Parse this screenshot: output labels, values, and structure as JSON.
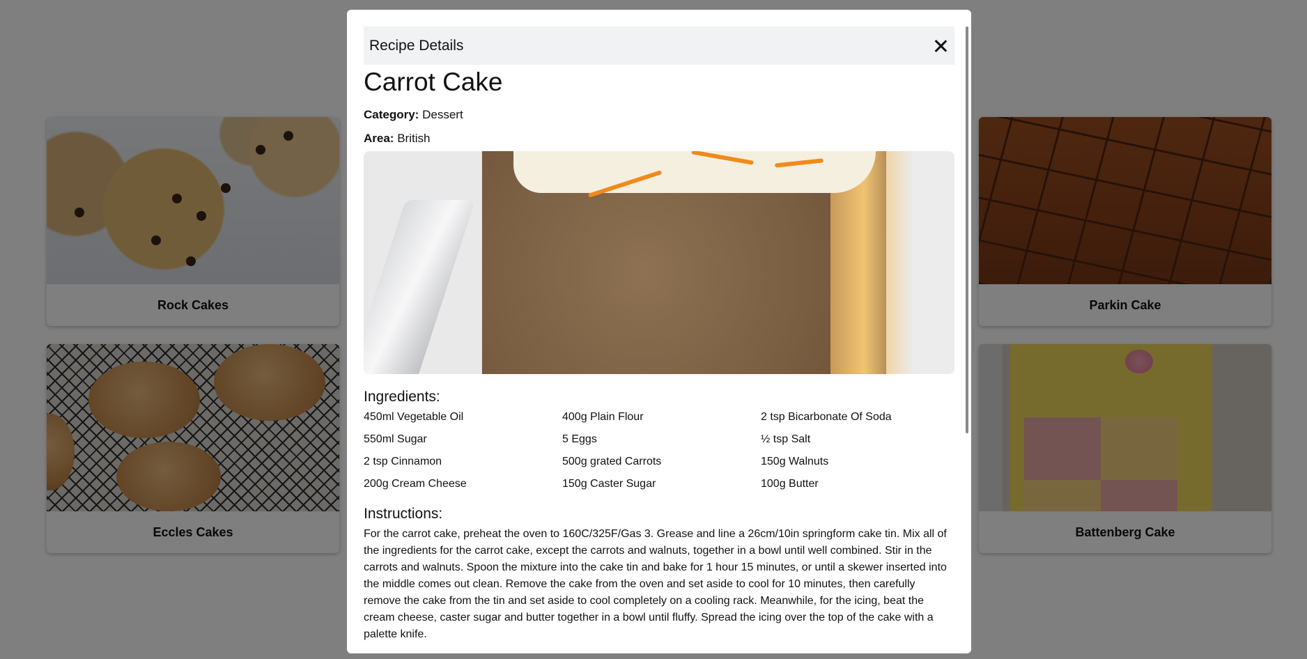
{
  "cards": [
    {
      "title": "Rock Cakes"
    },
    {
      "title": "Eccles Cakes"
    },
    {
      "title": "Parkin Cake"
    },
    {
      "title": "Battenberg Cake"
    }
  ],
  "modal": {
    "header": "Recipe Details",
    "close_icon": "close-icon",
    "recipe_title": "Carrot Cake",
    "category_label": "Category:",
    "category": "Dessert",
    "area_label": "Area:",
    "area": "British",
    "ingredients_title": "Ingredients:",
    "ingredients": [
      "450ml Vegetable Oil",
      "400g Plain Flour",
      "2 tsp Bicarbonate Of Soda",
      "550ml Sugar",
      "5 Eggs",
      "½ tsp Salt",
      "2 tsp Cinnamon",
      "500g grated Carrots",
      "150g Walnuts",
      "200g Cream Cheese",
      "150g Caster Sugar",
      "100g Butter"
    ],
    "instructions_title": "Instructions:",
    "instructions": "For the carrot cake, preheat the oven to 160C/325F/Gas 3. Grease and line a 26cm/10in springform cake tin. Mix all of the ingredients for the carrot cake, except the carrots and walnuts, together in a bowl until well combined. Stir in the carrots and walnuts. Spoon the mixture into the cake tin and bake for 1 hour 15 minutes, or until a skewer inserted into the middle comes out clean. Remove the cake from the oven and set aside to cool for 10 minutes, then carefully remove the cake from the tin and set aside to cool completely on a cooling rack. Meanwhile, for the icing, beat the cream cheese, caster sugar and butter together in a bowl until fluffy. Spread the icing over the top of the cake with a palette knife."
  }
}
